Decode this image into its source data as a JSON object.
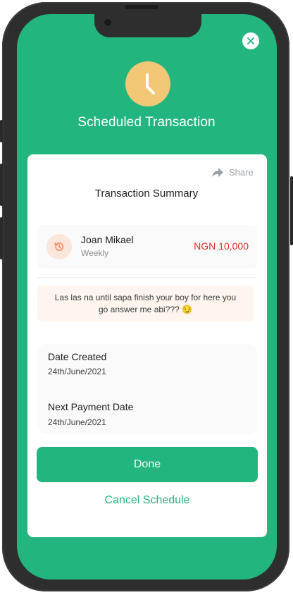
{
  "header": {
    "title": "Scheduled Transaction",
    "icon": "clock-icon",
    "close_icon": "close-icon"
  },
  "card": {
    "share_label": "Share",
    "summary_title": "Transaction Summary",
    "recipient": {
      "name": "Joan Mikael",
      "frequency": "Weekly",
      "amount": "NGN 10,000",
      "icon": "history-icon"
    },
    "note": "Las las na until sapa finish your boy for here you go answer me abi??? 😏",
    "dates": {
      "created_label": "Date Created",
      "created_value": "24th/June/2021",
      "next_label": "Next Payment Date",
      "next_value": "24th/June/2021"
    },
    "done_label": "Done",
    "cancel_label": "Cancel Schedule"
  },
  "colors": {
    "brand": "#22b57e",
    "clock": "#f2c877",
    "amount": "#e0312d",
    "history_icon": "#ef8a5e"
  }
}
